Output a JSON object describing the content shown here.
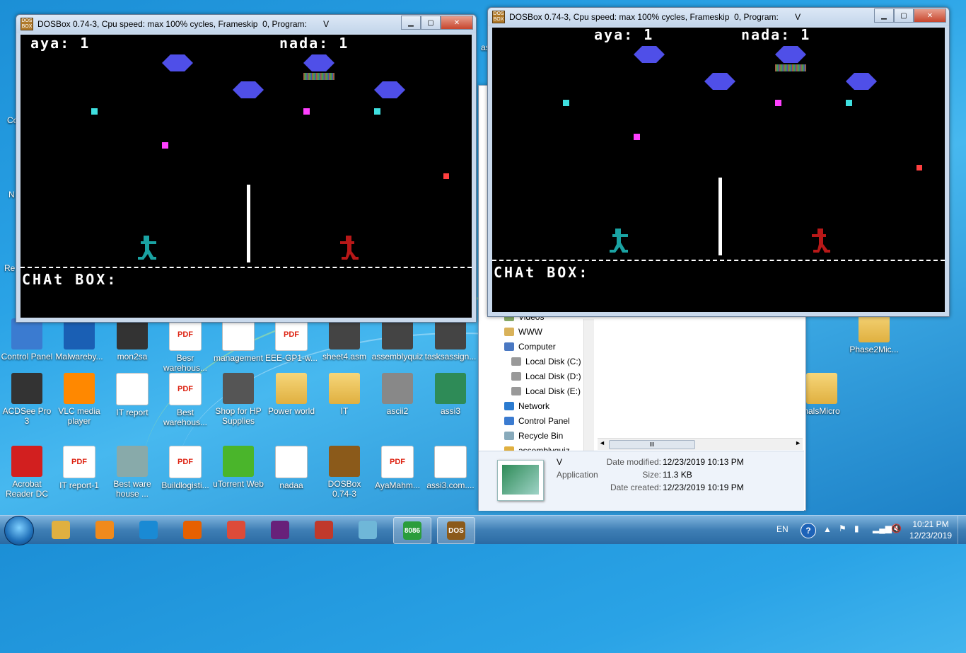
{
  "desktop": {
    "icons": [
      {
        "label": "Control Panel",
        "glyph": "control-panel-icon",
        "color": "#3b7bd0"
      },
      {
        "label": "Malwareby...",
        "glyph": "malwarebytes-icon",
        "color": "#1a5fb4"
      },
      {
        "label": "mon2sa",
        "glyph": "file-icon",
        "color": "#333333"
      },
      {
        "label": "Besr warehous...",
        "glyph": "pdf-icon",
        "color": "#d21f1f"
      },
      {
        "label": "management",
        "glyph": "document-icon",
        "color": "#4a78c2"
      },
      {
        "label": "EEE-GP1-w...",
        "glyph": "pdf-icon",
        "color": "#d21f1f"
      },
      {
        "label": "sheet4.asm",
        "glyph": "asm-file-icon",
        "color": "#444444"
      },
      {
        "label": "assemblyquiz",
        "glyph": "asm-file-icon",
        "color": "#444444"
      },
      {
        "label": "tasksassign...",
        "glyph": "asm-file-icon",
        "color": "#444444"
      },
      {
        "label": "ACDSee Pro 3",
        "glyph": "camera-icon",
        "color": "#333333"
      },
      {
        "label": "VLC media player",
        "glyph": "vlc-icon",
        "color": "#ff8800"
      },
      {
        "label": "IT report",
        "glyph": "word-icon",
        "color": "#2b579a"
      },
      {
        "label": "Best warehous...",
        "glyph": "pdf-icon",
        "color": "#d21f1f"
      },
      {
        "label": "Shop for HP Supplies",
        "glyph": "hp-icon",
        "color": "#555555"
      },
      {
        "label": "Power world",
        "glyph": "folder-icon",
        "color": "#e0b040"
      },
      {
        "label": "IT",
        "glyph": "folder-icon",
        "color": "#e0b040"
      },
      {
        "label": "ascii2",
        "glyph": "spreadsheet-icon",
        "color": "#888888"
      },
      {
        "label": "assi3",
        "glyph": "image-icon",
        "color": "#2e8b57"
      },
      {
        "label": "Acrobat Reader DC",
        "glyph": "acrobat-icon",
        "color": "#d21f1f"
      },
      {
        "label": "IT report-1",
        "glyph": "pdf-icon",
        "color": "#d21f1f"
      },
      {
        "label": "Best ware house ...",
        "glyph": "map-icon",
        "color": "#8aa"
      },
      {
        "label": "Buildlogisti...",
        "glyph": "pdf-icon",
        "color": "#d21f1f"
      },
      {
        "label": "uTorrent Web",
        "glyph": "utorrent-icon",
        "color": "#4ab52b"
      },
      {
        "label": "nadaa",
        "glyph": "document-icon",
        "color": "#777777"
      },
      {
        "label": "DOSBox 0.74-3",
        "glyph": "dosbox-icon",
        "color": "#8b5a1a"
      },
      {
        "label": "AyaMahm...",
        "glyph": "pdf-icon",
        "color": "#d21f1f"
      },
      {
        "label": "assi3.com....",
        "glyph": "blank-file-icon",
        "color": "#ffffff"
      },
      {
        "label": "Phase2Mic...",
        "glyph": "folder-icon",
        "color": "#e0b040"
      },
      {
        "label": "nalsMicro",
        "glyph": "folder-icon",
        "color": "#e0b040"
      }
    ],
    "partial_labels": [
      "Co",
      "N",
      "Re",
      "as"
    ]
  },
  "dosbox_left": {
    "title": "DOSBox 0.74-3, Cpu speed: max 100% cycles, Frameskip  0, Program:       V",
    "score_left": "aya: 1",
    "score_right": "nada: 1",
    "chat_label": "CHAt BOX:"
  },
  "dosbox_right": {
    "title": "DOSBox 0.74-3, Cpu speed: max 100% cycles, Frameskip  0, Program:       V",
    "score_left": "aya: 1",
    "score_right": "nada: 1",
    "chat_label": "CHAt BOX:"
  },
  "explorer": {
    "nav_items": [
      {
        "label": "Videos",
        "icon": "videos-icon"
      },
      {
        "label": "WWW",
        "icon": "library-icon"
      },
      {
        "label": "Computer",
        "icon": "computer-icon"
      },
      {
        "label": "Local Disk (C:)",
        "icon": "disk-icon"
      },
      {
        "label": "Local Disk (D:)",
        "icon": "disk-icon"
      },
      {
        "label": "Local Disk (E:)",
        "icon": "disk-icon"
      },
      {
        "label": "Network",
        "icon": "network-icon"
      },
      {
        "label": "Control Panel",
        "icon": "control-panel-icon"
      },
      {
        "label": "Recycle Bin",
        "icon": "recycle-bin-icon"
      },
      {
        "label": "assemblyquiz",
        "icon": "folder-icon"
      }
    ],
    "scroll_grip": "III",
    "details": {
      "name": "V",
      "type": "Application",
      "modified_label": "Date modified:",
      "modified_value": "12/23/2019 10:13 PM",
      "size_label": "Size:",
      "size_value": "11.3 KB",
      "created_label": "Date created:",
      "created_value": "12/23/2019 10:19 PM"
    }
  },
  "taskbar": {
    "language": "EN",
    "time": "10:21 PM",
    "date": "12/23/2019",
    "buttons": [
      {
        "name": "explorer-taskbar-button",
        "glyph": "folder-icon",
        "color": "#e0b040"
      },
      {
        "name": "media-player-taskbar-button",
        "glyph": "media-player-icon",
        "color": "#f08a1c"
      },
      {
        "name": "ie-taskbar-button",
        "glyph": "ie-icon",
        "color": "#1a8ad4"
      },
      {
        "name": "firefox-taskbar-button",
        "glyph": "firefox-icon",
        "color": "#e66000"
      },
      {
        "name": "chrome-taskbar-button",
        "glyph": "chrome-icon",
        "color": "#dd4b39"
      },
      {
        "name": "visual-studio-taskbar-button",
        "glyph": "visual-studio-icon",
        "color": "#68217a"
      },
      {
        "name": "toolbox-taskbar-button",
        "glyph": "toolbox-icon",
        "color": "#c0392b"
      },
      {
        "name": "notepad-taskbar-button",
        "glyph": "notepad-icon",
        "color": "#6fb7d8"
      },
      {
        "name": "emu8086-taskbar-button",
        "glyph": "chip-icon",
        "color": "#2a9d3c",
        "text": "8086"
      },
      {
        "name": "dosbox-taskbar-button",
        "glyph": "dosbox-icon",
        "color": "#8b5a1a",
        "text": "DOS"
      }
    ]
  }
}
